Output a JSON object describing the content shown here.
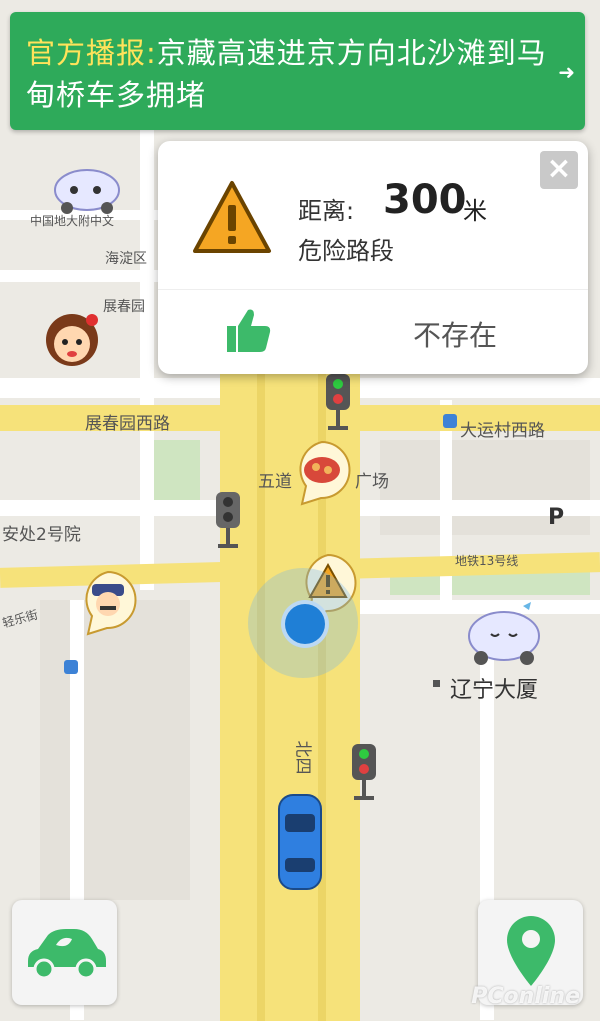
{
  "banner": {
    "prefix": "官方播报:",
    "text": "京藏高速进京方向北沙滩到马甸桥车多拥堵"
  },
  "popup": {
    "distance_label": "距离:",
    "distance_value": "300",
    "distance_unit": "米",
    "hazard_type": "危险路段",
    "not_exist_label": "不存在",
    "close_glyph": "×"
  },
  "map_labels": {
    "l1": "中国地大附中文",
    "l2": "海淀区",
    "l3": "展春园",
    "l4": "展春园西路",
    "l5": "大运村西路",
    "l6": "五道",
    "l7": "广场",
    "l8": "安处2号院",
    "l9": "地铁13号线",
    "l10": "辽宁大厦",
    "l11": "北四",
    "l12": "P",
    "l13": "轻乐街"
  },
  "watermark": "PConline",
  "colors": {
    "banner_green": "#2eaa5a",
    "banner_highlight": "#ffe35a",
    "road_yellow": "#f6e27a",
    "warning_orange": "#f5a623"
  }
}
